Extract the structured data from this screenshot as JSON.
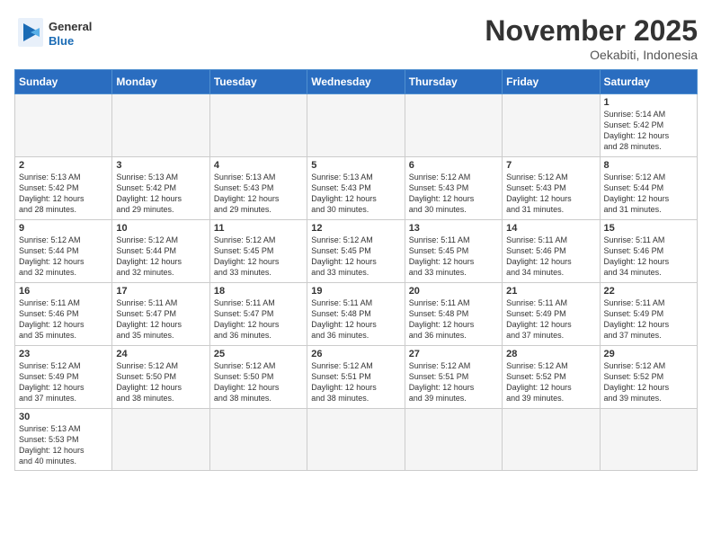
{
  "header": {
    "logo_general": "General",
    "logo_blue": "Blue",
    "month_title": "November 2025",
    "location": "Oekabiti, Indonesia"
  },
  "weekdays": [
    "Sunday",
    "Monday",
    "Tuesday",
    "Wednesday",
    "Thursday",
    "Friday",
    "Saturday"
  ],
  "weeks": [
    [
      {
        "day": "",
        "info": ""
      },
      {
        "day": "",
        "info": ""
      },
      {
        "day": "",
        "info": ""
      },
      {
        "day": "",
        "info": ""
      },
      {
        "day": "",
        "info": ""
      },
      {
        "day": "",
        "info": ""
      },
      {
        "day": "1",
        "info": "Sunrise: 5:14 AM\nSunset: 5:42 PM\nDaylight: 12 hours\nand 28 minutes."
      }
    ],
    [
      {
        "day": "2",
        "info": "Sunrise: 5:13 AM\nSunset: 5:42 PM\nDaylight: 12 hours\nand 28 minutes."
      },
      {
        "day": "3",
        "info": "Sunrise: 5:13 AM\nSunset: 5:42 PM\nDaylight: 12 hours\nand 29 minutes."
      },
      {
        "day": "4",
        "info": "Sunrise: 5:13 AM\nSunset: 5:43 PM\nDaylight: 12 hours\nand 29 minutes."
      },
      {
        "day": "5",
        "info": "Sunrise: 5:13 AM\nSunset: 5:43 PM\nDaylight: 12 hours\nand 30 minutes."
      },
      {
        "day": "6",
        "info": "Sunrise: 5:12 AM\nSunset: 5:43 PM\nDaylight: 12 hours\nand 30 minutes."
      },
      {
        "day": "7",
        "info": "Sunrise: 5:12 AM\nSunset: 5:43 PM\nDaylight: 12 hours\nand 31 minutes."
      },
      {
        "day": "8",
        "info": "Sunrise: 5:12 AM\nSunset: 5:44 PM\nDaylight: 12 hours\nand 31 minutes."
      }
    ],
    [
      {
        "day": "9",
        "info": "Sunrise: 5:12 AM\nSunset: 5:44 PM\nDaylight: 12 hours\nand 32 minutes."
      },
      {
        "day": "10",
        "info": "Sunrise: 5:12 AM\nSunset: 5:44 PM\nDaylight: 12 hours\nand 32 minutes."
      },
      {
        "day": "11",
        "info": "Sunrise: 5:12 AM\nSunset: 5:45 PM\nDaylight: 12 hours\nand 33 minutes."
      },
      {
        "day": "12",
        "info": "Sunrise: 5:12 AM\nSunset: 5:45 PM\nDaylight: 12 hours\nand 33 minutes."
      },
      {
        "day": "13",
        "info": "Sunrise: 5:11 AM\nSunset: 5:45 PM\nDaylight: 12 hours\nand 33 minutes."
      },
      {
        "day": "14",
        "info": "Sunrise: 5:11 AM\nSunset: 5:46 PM\nDaylight: 12 hours\nand 34 minutes."
      },
      {
        "day": "15",
        "info": "Sunrise: 5:11 AM\nSunset: 5:46 PM\nDaylight: 12 hours\nand 34 minutes."
      }
    ],
    [
      {
        "day": "16",
        "info": "Sunrise: 5:11 AM\nSunset: 5:46 PM\nDaylight: 12 hours\nand 35 minutes."
      },
      {
        "day": "17",
        "info": "Sunrise: 5:11 AM\nSunset: 5:47 PM\nDaylight: 12 hours\nand 35 minutes."
      },
      {
        "day": "18",
        "info": "Sunrise: 5:11 AM\nSunset: 5:47 PM\nDaylight: 12 hours\nand 36 minutes."
      },
      {
        "day": "19",
        "info": "Sunrise: 5:11 AM\nSunset: 5:48 PM\nDaylight: 12 hours\nand 36 minutes."
      },
      {
        "day": "20",
        "info": "Sunrise: 5:11 AM\nSunset: 5:48 PM\nDaylight: 12 hours\nand 36 minutes."
      },
      {
        "day": "21",
        "info": "Sunrise: 5:11 AM\nSunset: 5:49 PM\nDaylight: 12 hours\nand 37 minutes."
      },
      {
        "day": "22",
        "info": "Sunrise: 5:11 AM\nSunset: 5:49 PM\nDaylight: 12 hours\nand 37 minutes."
      }
    ],
    [
      {
        "day": "23",
        "info": "Sunrise: 5:12 AM\nSunset: 5:49 PM\nDaylight: 12 hours\nand 37 minutes."
      },
      {
        "day": "24",
        "info": "Sunrise: 5:12 AM\nSunset: 5:50 PM\nDaylight: 12 hours\nand 38 minutes."
      },
      {
        "day": "25",
        "info": "Sunrise: 5:12 AM\nSunset: 5:50 PM\nDaylight: 12 hours\nand 38 minutes."
      },
      {
        "day": "26",
        "info": "Sunrise: 5:12 AM\nSunset: 5:51 PM\nDaylight: 12 hours\nand 38 minutes."
      },
      {
        "day": "27",
        "info": "Sunrise: 5:12 AM\nSunset: 5:51 PM\nDaylight: 12 hours\nand 39 minutes."
      },
      {
        "day": "28",
        "info": "Sunrise: 5:12 AM\nSunset: 5:52 PM\nDaylight: 12 hours\nand 39 minutes."
      },
      {
        "day": "29",
        "info": "Sunrise: 5:12 AM\nSunset: 5:52 PM\nDaylight: 12 hours\nand 39 minutes."
      }
    ],
    [
      {
        "day": "30",
        "info": "Sunrise: 5:13 AM\nSunset: 5:53 PM\nDaylight: 12 hours\nand 40 minutes."
      },
      {
        "day": "",
        "info": ""
      },
      {
        "day": "",
        "info": ""
      },
      {
        "day": "",
        "info": ""
      },
      {
        "day": "",
        "info": ""
      },
      {
        "day": "",
        "info": ""
      },
      {
        "day": "",
        "info": ""
      }
    ]
  ]
}
